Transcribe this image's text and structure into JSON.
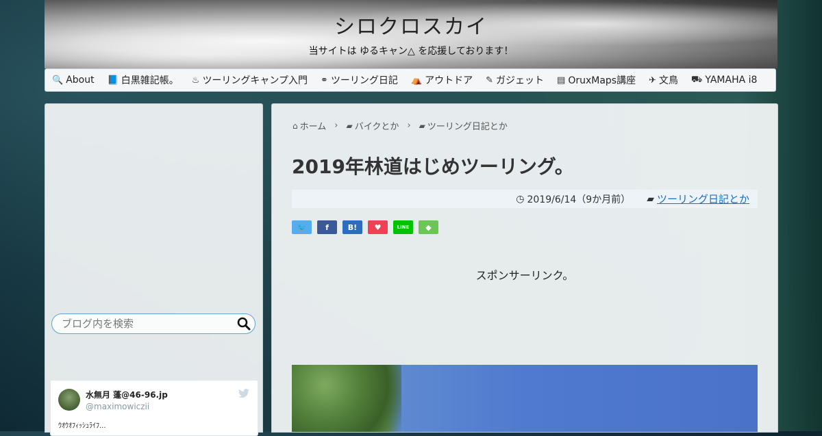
{
  "header": {
    "title": "シロクロスカイ",
    "tagline": "当サイトは ゆるキャン△ を応援しております！"
  },
  "nav": {
    "items": [
      {
        "icon": "search-icon",
        "glyph": "🔍",
        "label": "About"
      },
      {
        "icon": "book-icon",
        "glyph": "📘",
        "label": "白黒雑記帳。"
      },
      {
        "icon": "campfire-icon",
        "glyph": "♨",
        "label": "ツーリングキャンプ入門"
      },
      {
        "icon": "motorcycle-icon",
        "glyph": "⚭",
        "label": "ツーリング日記"
      },
      {
        "icon": "tent-icon",
        "glyph": "⛺",
        "label": "アウトドア"
      },
      {
        "icon": "gadget-icon",
        "glyph": "✎",
        "label": "ガジェット"
      },
      {
        "icon": "map-icon",
        "glyph": "▤",
        "label": "OruxMaps講座"
      },
      {
        "icon": "bird-icon",
        "glyph": "✈",
        "label": "文鳥"
      },
      {
        "icon": "scooter-icon",
        "glyph": "⛟",
        "label": "YAMAHA i8"
      }
    ]
  },
  "sidebar": {
    "search": {
      "placeholder": "ブログ内を検索"
    },
    "tweet": {
      "name": "水無月 蓬@46-96.jp",
      "handle": "@maximowiczii",
      "text": "ｳｵｳｵﾌｨｯｼｭﾗｲﾌ..."
    }
  },
  "main": {
    "breadcrumb": [
      {
        "icon": "home-icon",
        "glyph": "⌂",
        "label": "ホーム"
      },
      {
        "icon": "folder-icon",
        "glyph": "▰",
        "label": "バイクとか"
      },
      {
        "icon": "folder-icon",
        "glyph": "▰",
        "label": "ツーリング日記とか"
      }
    ],
    "breadcrumb_sep": "›",
    "title": "2019年林道はじめツーリング。",
    "meta": {
      "date": "2019/6/14（9か月前）",
      "category": "ツーリング日記とか"
    },
    "share": [
      {
        "name": "twitter-share-button",
        "glyph": "🐦",
        "color": "#55acee"
      },
      {
        "name": "facebook-share-button",
        "glyph": "f",
        "color": "#3b5998"
      },
      {
        "name": "hatena-share-button",
        "glyph": "B!",
        "color": "#2c6ebd"
      },
      {
        "name": "pocket-share-button",
        "glyph": "♥",
        "color": "#ef4056"
      },
      {
        "name": "line-share-button",
        "glyph": "LINE",
        "color": "#00c300"
      },
      {
        "name": "feedly-share-button",
        "glyph": "◆",
        "color": "#6cc655"
      }
    ],
    "sponsor_label": "スポンサーリンク。"
  }
}
